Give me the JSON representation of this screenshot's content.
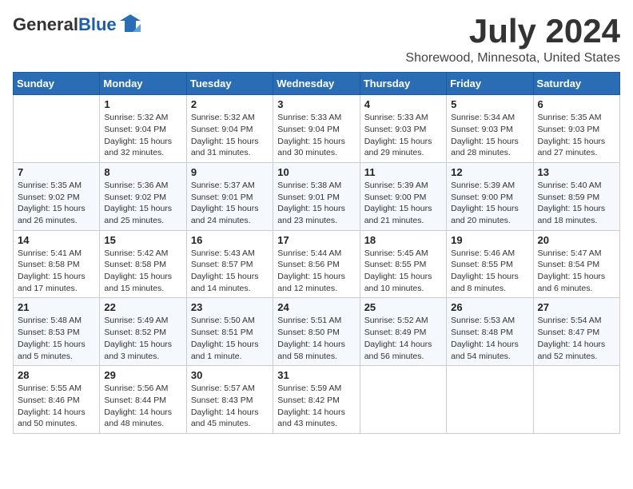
{
  "logo": {
    "general": "General",
    "blue": "Blue"
  },
  "title": "July 2024",
  "location": "Shorewood, Minnesota, United States",
  "days_of_week": [
    "Sunday",
    "Monday",
    "Tuesday",
    "Wednesday",
    "Thursday",
    "Friday",
    "Saturday"
  ],
  "weeks": [
    [
      {
        "day": "",
        "info": ""
      },
      {
        "day": "1",
        "info": "Sunrise: 5:32 AM\nSunset: 9:04 PM\nDaylight: 15 hours\nand 32 minutes."
      },
      {
        "day": "2",
        "info": "Sunrise: 5:32 AM\nSunset: 9:04 PM\nDaylight: 15 hours\nand 31 minutes."
      },
      {
        "day": "3",
        "info": "Sunrise: 5:33 AM\nSunset: 9:04 PM\nDaylight: 15 hours\nand 30 minutes."
      },
      {
        "day": "4",
        "info": "Sunrise: 5:33 AM\nSunset: 9:03 PM\nDaylight: 15 hours\nand 29 minutes."
      },
      {
        "day": "5",
        "info": "Sunrise: 5:34 AM\nSunset: 9:03 PM\nDaylight: 15 hours\nand 28 minutes."
      },
      {
        "day": "6",
        "info": "Sunrise: 5:35 AM\nSunset: 9:03 PM\nDaylight: 15 hours\nand 27 minutes."
      }
    ],
    [
      {
        "day": "7",
        "info": "Sunrise: 5:35 AM\nSunset: 9:02 PM\nDaylight: 15 hours\nand 26 minutes."
      },
      {
        "day": "8",
        "info": "Sunrise: 5:36 AM\nSunset: 9:02 PM\nDaylight: 15 hours\nand 25 minutes."
      },
      {
        "day": "9",
        "info": "Sunrise: 5:37 AM\nSunset: 9:01 PM\nDaylight: 15 hours\nand 24 minutes."
      },
      {
        "day": "10",
        "info": "Sunrise: 5:38 AM\nSunset: 9:01 PM\nDaylight: 15 hours\nand 23 minutes."
      },
      {
        "day": "11",
        "info": "Sunrise: 5:39 AM\nSunset: 9:00 PM\nDaylight: 15 hours\nand 21 minutes."
      },
      {
        "day": "12",
        "info": "Sunrise: 5:39 AM\nSunset: 9:00 PM\nDaylight: 15 hours\nand 20 minutes."
      },
      {
        "day": "13",
        "info": "Sunrise: 5:40 AM\nSunset: 8:59 PM\nDaylight: 15 hours\nand 18 minutes."
      }
    ],
    [
      {
        "day": "14",
        "info": "Sunrise: 5:41 AM\nSunset: 8:58 PM\nDaylight: 15 hours\nand 17 minutes."
      },
      {
        "day": "15",
        "info": "Sunrise: 5:42 AM\nSunset: 8:58 PM\nDaylight: 15 hours\nand 15 minutes."
      },
      {
        "day": "16",
        "info": "Sunrise: 5:43 AM\nSunset: 8:57 PM\nDaylight: 15 hours\nand 14 minutes."
      },
      {
        "day": "17",
        "info": "Sunrise: 5:44 AM\nSunset: 8:56 PM\nDaylight: 15 hours\nand 12 minutes."
      },
      {
        "day": "18",
        "info": "Sunrise: 5:45 AM\nSunset: 8:55 PM\nDaylight: 15 hours\nand 10 minutes."
      },
      {
        "day": "19",
        "info": "Sunrise: 5:46 AM\nSunset: 8:55 PM\nDaylight: 15 hours\nand 8 minutes."
      },
      {
        "day": "20",
        "info": "Sunrise: 5:47 AM\nSunset: 8:54 PM\nDaylight: 15 hours\nand 6 minutes."
      }
    ],
    [
      {
        "day": "21",
        "info": "Sunrise: 5:48 AM\nSunset: 8:53 PM\nDaylight: 15 hours\nand 5 minutes."
      },
      {
        "day": "22",
        "info": "Sunrise: 5:49 AM\nSunset: 8:52 PM\nDaylight: 15 hours\nand 3 minutes."
      },
      {
        "day": "23",
        "info": "Sunrise: 5:50 AM\nSunset: 8:51 PM\nDaylight: 15 hours\nand 1 minute."
      },
      {
        "day": "24",
        "info": "Sunrise: 5:51 AM\nSunset: 8:50 PM\nDaylight: 14 hours\nand 58 minutes."
      },
      {
        "day": "25",
        "info": "Sunrise: 5:52 AM\nSunset: 8:49 PM\nDaylight: 14 hours\nand 56 minutes."
      },
      {
        "day": "26",
        "info": "Sunrise: 5:53 AM\nSunset: 8:48 PM\nDaylight: 14 hours\nand 54 minutes."
      },
      {
        "day": "27",
        "info": "Sunrise: 5:54 AM\nSunset: 8:47 PM\nDaylight: 14 hours\nand 52 minutes."
      }
    ],
    [
      {
        "day": "28",
        "info": "Sunrise: 5:55 AM\nSunset: 8:46 PM\nDaylight: 14 hours\nand 50 minutes."
      },
      {
        "day": "29",
        "info": "Sunrise: 5:56 AM\nSunset: 8:44 PM\nDaylight: 14 hours\nand 48 minutes."
      },
      {
        "day": "30",
        "info": "Sunrise: 5:57 AM\nSunset: 8:43 PM\nDaylight: 14 hours\nand 45 minutes."
      },
      {
        "day": "31",
        "info": "Sunrise: 5:59 AM\nSunset: 8:42 PM\nDaylight: 14 hours\nand 43 minutes."
      },
      {
        "day": "",
        "info": ""
      },
      {
        "day": "",
        "info": ""
      },
      {
        "day": "",
        "info": ""
      }
    ]
  ]
}
